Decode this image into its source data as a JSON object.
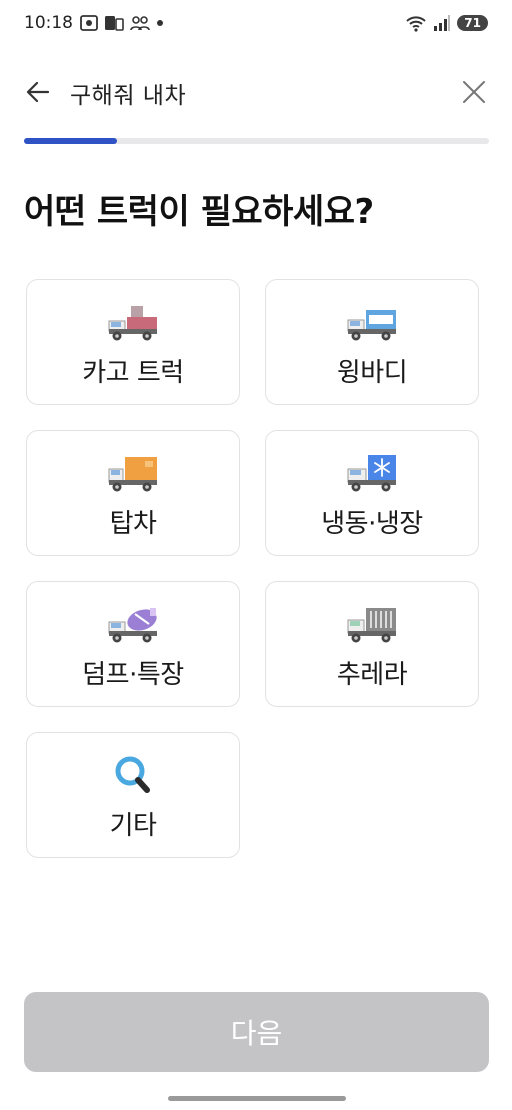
{
  "status_bar": {
    "time": "10:18",
    "battery": "71"
  },
  "header": {
    "title": "구해줘 내차"
  },
  "progress": {
    "value": 0.2
  },
  "question": "어떤 트럭이 필요하세요?",
  "options": [
    {
      "label": "카고 트럭",
      "icon": "cargo-truck-icon"
    },
    {
      "label": "윙바디",
      "icon": "wingbody-truck-icon"
    },
    {
      "label": "탑차",
      "icon": "box-truck-icon"
    },
    {
      "label": "냉동·냉장",
      "icon": "refrigerated-truck-icon"
    },
    {
      "label": "덤프·특장",
      "icon": "mixer-truck-icon"
    },
    {
      "label": "추레라",
      "icon": "trailer-truck-icon"
    },
    {
      "label": "기타",
      "icon": "search-icon"
    }
  ],
  "footer": {
    "next_label": "다음"
  },
  "colors": {
    "accent": "#2f53c4",
    "button_disabled": "#c4c4c6"
  }
}
